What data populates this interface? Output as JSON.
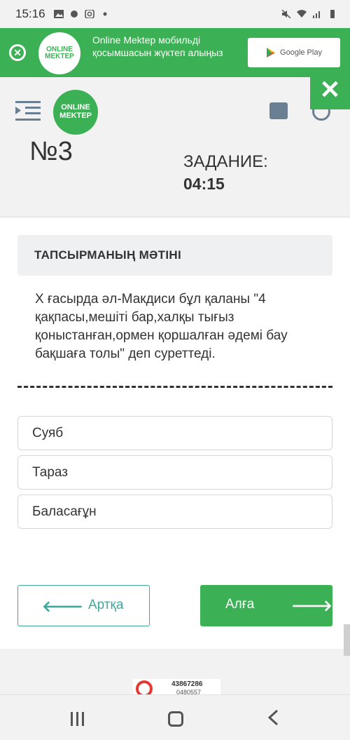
{
  "status_bar": {
    "time": "15:16"
  },
  "promo": {
    "logo_line1": "ONLINE",
    "logo_line2": "MEKTEP",
    "text": "Online Mektep мобильді қосымшасын жүктеп алыңыз",
    "store_label": "Google Play"
  },
  "header": {
    "logo_line1": "ONLINE",
    "logo_line2": "MEKTEP"
  },
  "task": {
    "number": "№3",
    "label": "ЗАДАНИЕ:",
    "timer": "04:15"
  },
  "content": {
    "heading": "ТАПСЫРМАНЫҢ МӘТІНІ",
    "question": "Х ғасырда әл-Макдиси бұл қаланы \"4 қақпасы,мешіті бар,халқы тығыз қоныстанған,ормен қоршалған әдемі бау бақшаға толы\" деп суреттеді.",
    "options": [
      "Суяб",
      "Тараз",
      "Баласағұн"
    ]
  },
  "nav_buttons": {
    "back_label": "Артқа",
    "next_label": "Алға"
  },
  "ad": {
    "line1": "43867286",
    "line2": "0480557"
  },
  "colors": {
    "brand_green": "#3cb054",
    "teal": "#3ea89a"
  }
}
